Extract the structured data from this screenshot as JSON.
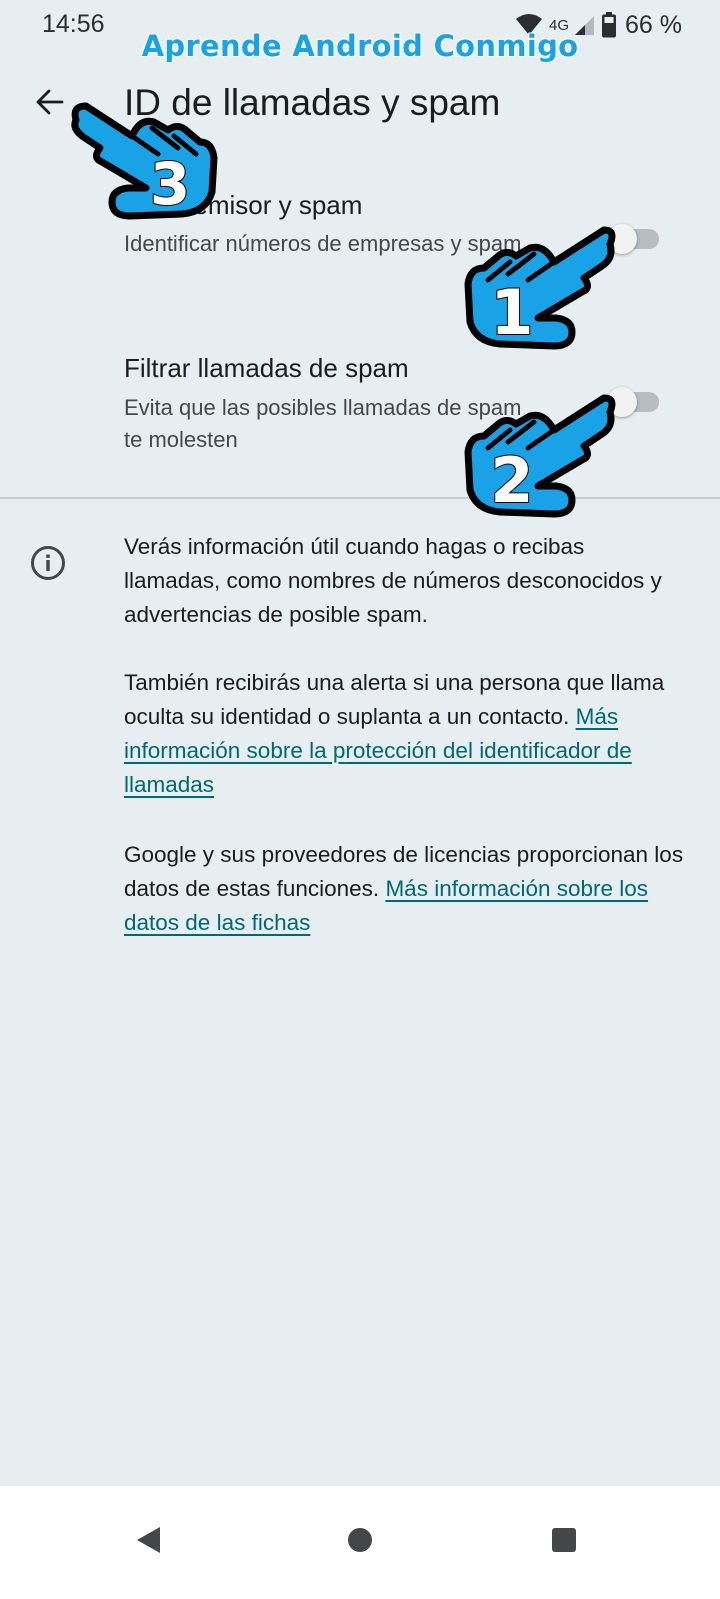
{
  "status_bar": {
    "time": "14:56",
    "network_type": "4G",
    "battery_percent": "66 %",
    "icons": [
      "wifi-icon",
      "cellular-signal-icon",
      "battery-icon"
    ]
  },
  "watermark": "Aprende Android Conmigo",
  "header": {
    "title": "ID de llamadas y spam",
    "back_icon": "arrow-left-icon"
  },
  "settings": [
    {
      "title": "ID de emisor y spam",
      "summary": "Identificar números de empresas y spam",
      "enabled": false
    },
    {
      "title": "Filtrar llamadas de spam",
      "summary": "Evita que las posibles llamadas de spam te molesten",
      "enabled": false
    }
  ],
  "info": {
    "icon": "info-icon",
    "paragraph1": "Verás información útil cuando hagas o recibas llamadas, como nombres de números desconocidos y advertencias de posible spam.",
    "paragraph2_text": "También recibirás una alerta si una persona que llama oculta su identidad o suplanta a un contacto.",
    "paragraph2_link": "Más información sobre la protección del identificador de llamadas",
    "paragraph3_text": "Google y sus proveedores de licencias proporcionan los datos de estas funciones.",
    "paragraph3_link": "Más información sobre los datos de las fichas"
  },
  "overlays": {
    "hand_1_label": "1",
    "hand_2_label": "2",
    "hand_3_label": "3",
    "hand_color": "#1aa2e6"
  },
  "nav_bar": {
    "icons": [
      "nav-back-icon",
      "nav-home-icon",
      "nav-recents-icon"
    ]
  },
  "colors": {
    "background": "#e7eef1",
    "link": "#006874",
    "watermark": "#1aa2e6"
  }
}
